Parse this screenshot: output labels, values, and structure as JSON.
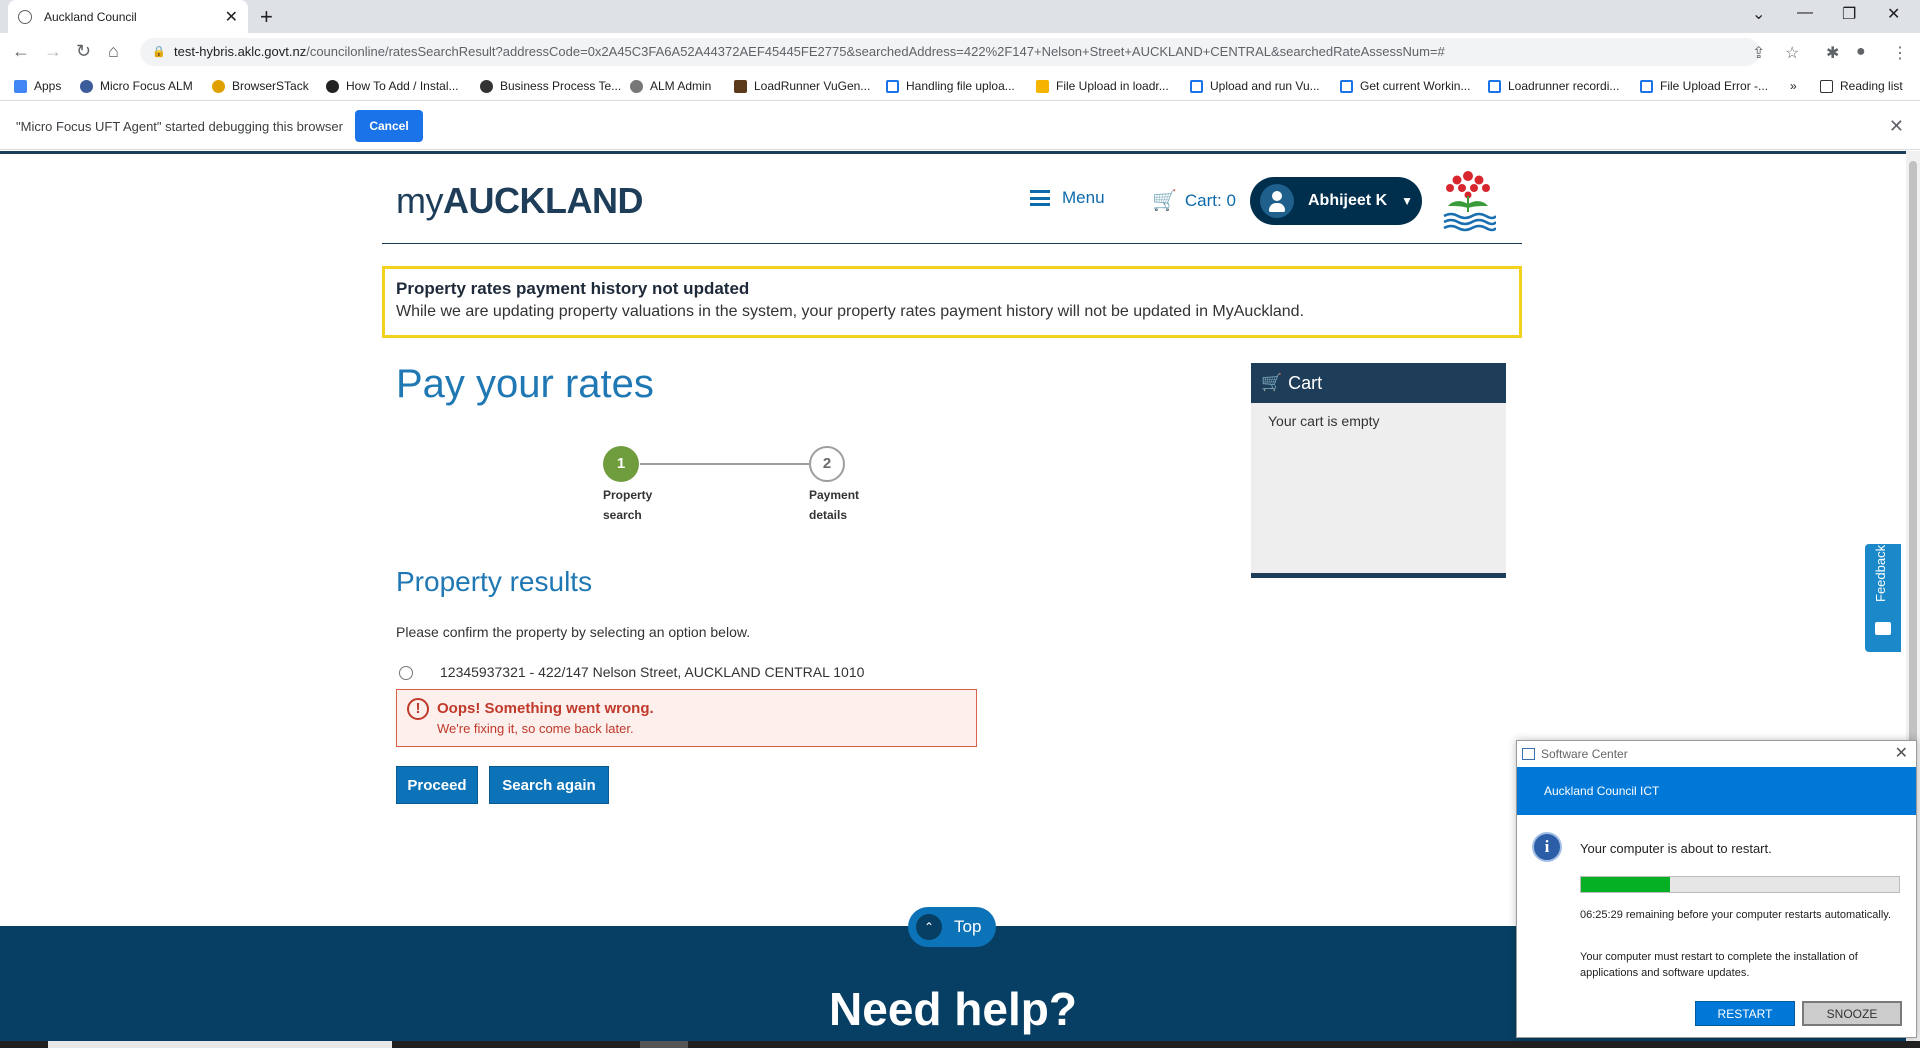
{
  "browser": {
    "tab_title": "Auckland Council",
    "url_host": "test-hybris.aklc.govt.nz",
    "url_path": "/councilonline/ratesSearchResult?addressCode=0x2A45C3FA6A52A44372AEF45445FE2775&searchedAddress=422%2F147+Nelson+Street+AUCKLAND+CENTRAL&searchedRateAssessNum=#",
    "bookmarks": [
      "Apps",
      "Micro Focus ALM",
      "BrowserSTack",
      "How To Add / Instal...",
      "Business Process Te...",
      "ALM Admin",
      "LoadRunner VuGen...",
      "Handling file uploa...",
      "File Upload in loadr...",
      "Upload and run Vu...",
      "Get current Workin...",
      "Loadrunner recordi...",
      "File Upload Error -..."
    ],
    "bookmark_overflow": "»",
    "reading_list": "Reading list",
    "infobar_message": "\"Micro Focus UFT Agent\" started debugging this browser",
    "infobar_cancel": "Cancel"
  },
  "site": {
    "logo_prefix": "my",
    "logo_main": "AUCKLAND",
    "menu_label": "Menu",
    "cart_label": "Cart: 0",
    "user_name": "Abhijeet K",
    "alert_title": "Property rates payment history not updated",
    "alert_text": "While we are updating property valuations in the system, your property rates payment history will not be updated in MyAuckland.",
    "page_title": "Pay your rates",
    "steps": [
      {
        "num": "1",
        "line1": "Property",
        "line2": "search"
      },
      {
        "num": "2",
        "line1": "Payment",
        "line2": "details"
      }
    ],
    "results_title": "Property results",
    "confirm_text": "Please confirm the property by selecting an option below.",
    "property_option": "12345937321 - 422/147 Nelson Street, AUCKLAND CENTRAL 1010",
    "error_title": "Oops! Something went wrong.",
    "error_text": "We're fixing it, so come back later.",
    "proceed_label": "Proceed",
    "search_again_label": "Search again",
    "cart_panel_title": "Cart",
    "cart_empty": "Your cart is empty",
    "feedback_label": "Feedback",
    "top_label": "Top",
    "need_help": "Need help?"
  },
  "software_center": {
    "window_title": "Software Center",
    "banner": "Auckland Council ICT",
    "message": "Your computer is about to restart.",
    "progress": 0.28,
    "remaining": "06:25:29 remaining before your computer restarts automatically.",
    "must_restart": "Your computer must restart to complete the installation of applications and software updates.",
    "restart_label": "RESTART",
    "snooze_label": "SNOOZE"
  },
  "colors": {
    "brand_navy": "#1e3d59",
    "link_blue": "#1f78b4",
    "step_done": "#6f9c3d",
    "alert_yellow": "#f2d21c",
    "error_red": "#c0392b"
  }
}
